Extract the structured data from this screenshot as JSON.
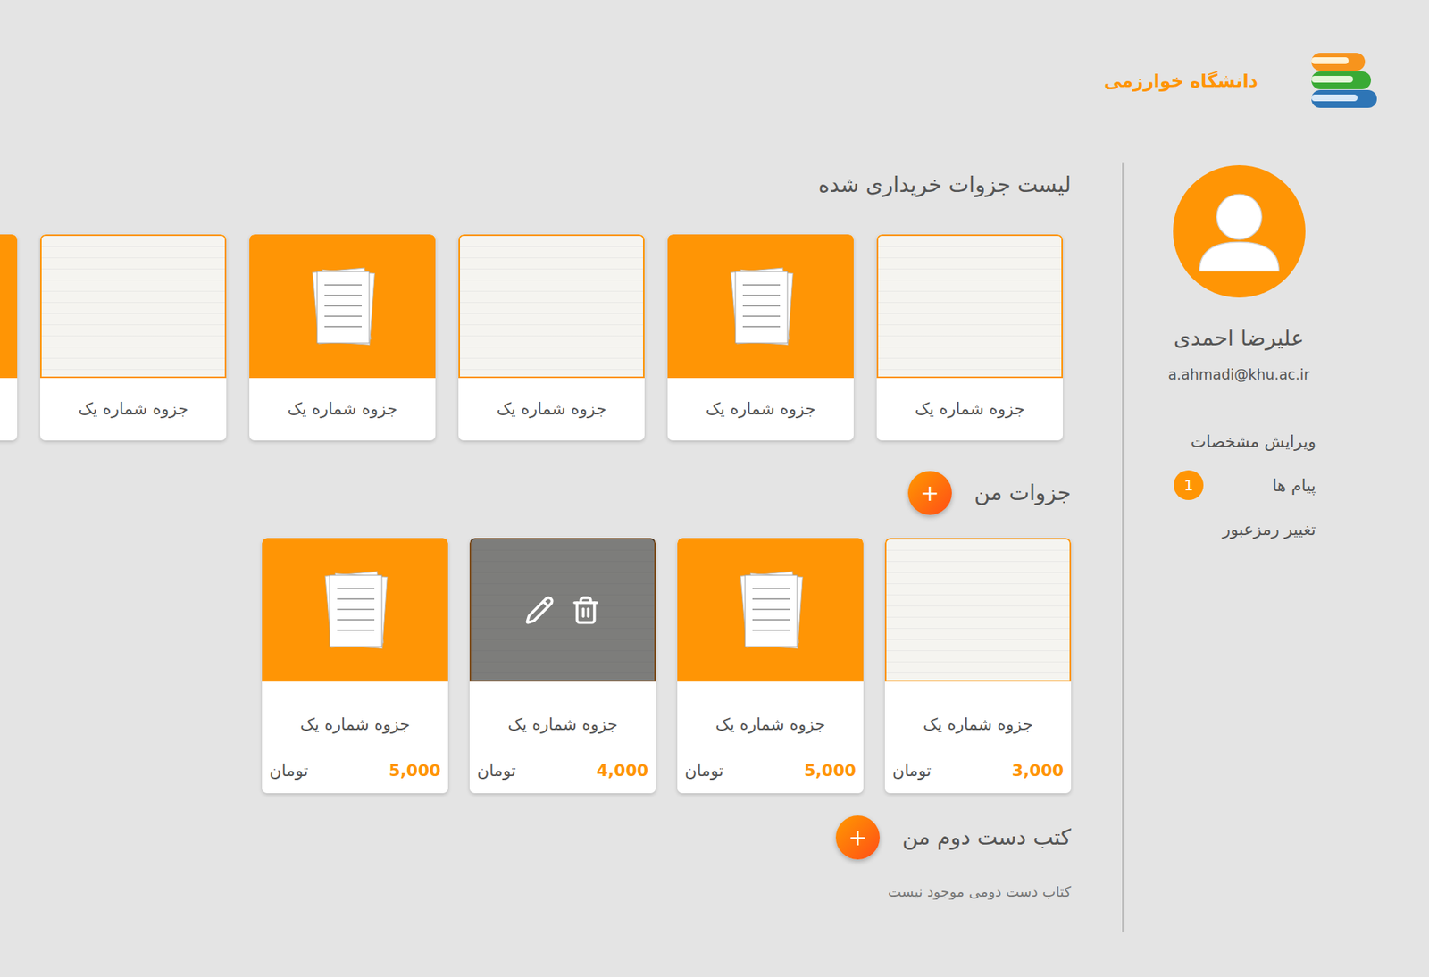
{
  "header": {
    "university": "دانشگاه خوارزمی"
  },
  "profile": {
    "name": "علیرضا احمدی",
    "email": "a.ahmadi@khu.ac.ir"
  },
  "menu": [
    {
      "label": "ویرایش مشخصات"
    },
    {
      "label": "پیام ها",
      "badge": "1"
    },
    {
      "label": "تغییر رمزعبور"
    }
  ],
  "purchased": {
    "title": "لیست جزوات خریداری شده",
    "items": [
      {
        "title": "جزوه شماره یک",
        "kind": "photo"
      },
      {
        "title": "جزوه شماره یک",
        "kind": "placeholder"
      },
      {
        "title": "جزوه شماره یک",
        "kind": "photo"
      },
      {
        "title": "جزوه شماره یک",
        "kind": "placeholder"
      },
      {
        "title": "جزوه شماره یک",
        "kind": "photo"
      },
      {
        "title": "",
        "kind": "placeholder"
      }
    ]
  },
  "my_notes": {
    "title": "جزوات من",
    "add_button": "+",
    "items": [
      {
        "title": "جزوه شماره یک",
        "kind": "photo",
        "price": "3,000",
        "currency": "تومان",
        "hovered": false
      },
      {
        "title": "جزوه شماره یک",
        "kind": "placeholder",
        "price": "5,000",
        "currency": "تومان",
        "hovered": false
      },
      {
        "title": "جزوه شماره یک",
        "kind": "photo",
        "price": "4,000",
        "currency": "تومان",
        "hovered": true
      },
      {
        "title": "جزوه شماره یک",
        "kind": "placeholder",
        "price": "5,000",
        "currency": "تومان",
        "hovered": false
      }
    ]
  },
  "my_books": {
    "title": "کتب دست دوم من",
    "add_button": "+",
    "empty_text": "کتاب دست دومی موجود نیست",
    "items": []
  }
}
